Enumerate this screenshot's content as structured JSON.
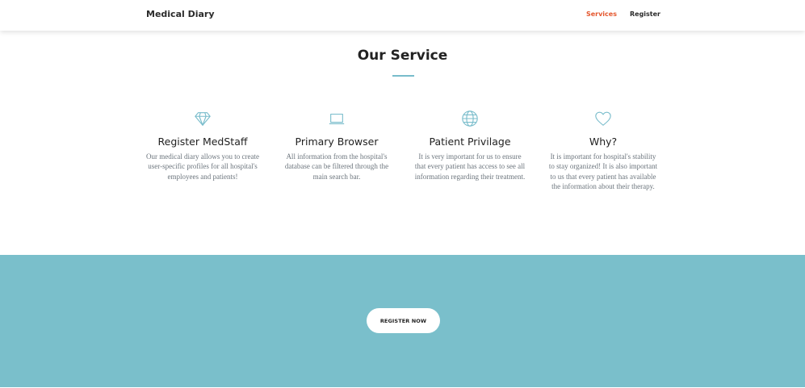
{
  "navbar": {
    "brand": "Medical Diary",
    "links": [
      {
        "label": "Services",
        "active": true
      },
      {
        "label": "Register",
        "active": false
      }
    ]
  },
  "services_section": {
    "title": "Our Service",
    "items": [
      {
        "icon": "diamond-icon",
        "title": "Register MedStaff",
        "text": "Our medical diary allows you to create user-specific profiles for all hospital's employees and patients!"
      },
      {
        "icon": "laptop-icon",
        "title": "Primary Browser",
        "text": "All information from the hospital's database can be filtered through the main search bar."
      },
      {
        "icon": "globe-icon",
        "title": "Patient Privilage",
        "text": "It is very important for us to ensure that every patient has access to see all information regarding their treatment."
      },
      {
        "icon": "heart-icon",
        "title": "Why?",
        "text": "It is important for hospital's stability to stay organized! It is also important to us that every patient has available the information about their therapy."
      }
    ]
  },
  "cta": {
    "button_label": "REGISTER NOW"
  },
  "colors": {
    "accent": "#78bccb",
    "cta_background": "#7abfcb",
    "active_nav": "#e4572e"
  }
}
